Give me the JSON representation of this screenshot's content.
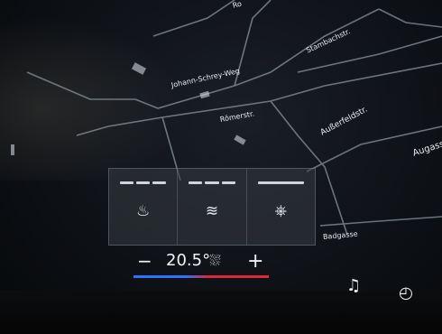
{
  "map": {
    "streets": [
      {
        "id": "ro",
        "label": "Ro"
      },
      {
        "id": "johann",
        "label": "Johann-Schrey-Weg"
      },
      {
        "id": "stambach",
        "label": "Stambachstr."
      },
      {
        "id": "roemer",
        "label": "Römerstr."
      },
      {
        "id": "aussenfeld",
        "label": "Außerfeldstr."
      },
      {
        "id": "augass",
        "label": "Augass"
      },
      {
        "id": "badgasse",
        "label": "Badgasse"
      }
    ]
  },
  "climate": {
    "seat_heat_left": {
      "icon": "seat-heating-icon",
      "level": 3
    },
    "seat_ventilation": {
      "icon": "seat-ventilation-icon",
      "level": 3
    },
    "steering_heat": {
      "icon": "steering-wheel-heating-icon",
      "level": 1
    },
    "temperature": "20.5°",
    "minus_label": "−",
    "plus_label": "+"
  },
  "dock": {
    "music_icon": "music-note-icon",
    "nav_icon": "navigation-icon"
  }
}
